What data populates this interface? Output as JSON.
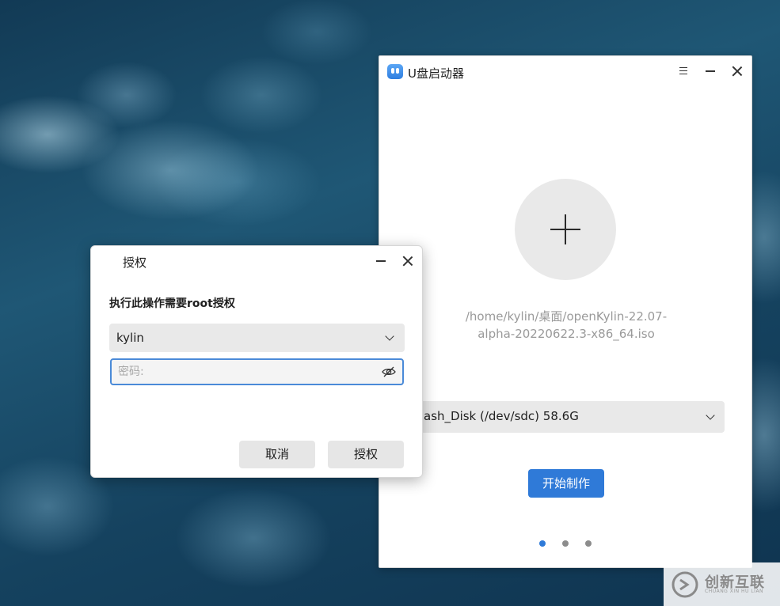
{
  "main_window": {
    "title": "U盘启动器",
    "iso_path_line1": "/home/kylin/桌面/openKylin-22.07-",
    "iso_path_line2": "alpha-20220622.3-x86_64.iso",
    "disk_select_value": "ash_Disk (/dev/sdc) 58.6G",
    "start_button": "开始制作",
    "page_dots": 3,
    "active_dot": 1
  },
  "auth_dialog": {
    "title": "授权",
    "prompt": "执行此操作需要root授权",
    "user_select_value": "kylin",
    "password_placeholder": "密码:",
    "password_value": "",
    "cancel_button": "取消",
    "authorize_button": "授权"
  },
  "watermark": {
    "text": "创新互联",
    "subtext": "CHUANG XIN HU LIAN"
  },
  "colors": {
    "accent": "#2f7ad8",
    "control_bg": "#e9e9e9",
    "focus_border": "#4a8ad8",
    "muted_text": "#9a9a9a"
  },
  "icons": {
    "app": "usb-launcher-icon",
    "menu": "hamburger-menu-icon",
    "minimize": "minimize-icon",
    "close": "close-icon",
    "add": "plus-icon",
    "dropdown": "chevron-down-icon",
    "reveal_password": "eye-slash-icon"
  }
}
